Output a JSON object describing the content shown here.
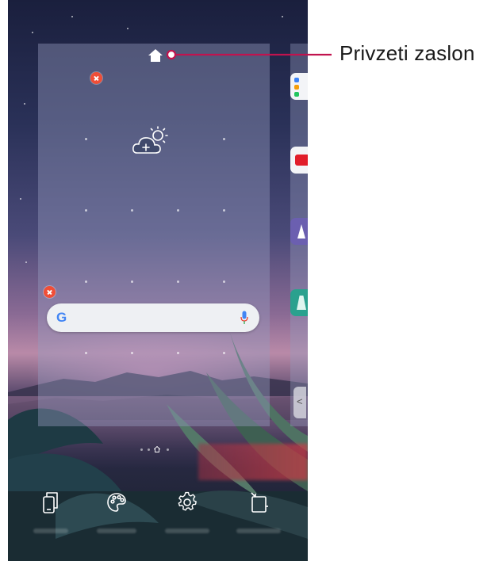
{
  "callout": {
    "label": "Privzeti zaslon"
  },
  "home_card": {
    "widgets": [
      "weather-widget",
      "google-search-bar"
    ]
  },
  "search_bar": {
    "logo": "G",
    "icons": [
      "google-logo",
      "mic-icon"
    ]
  },
  "page_indicator": {
    "pages": 4,
    "current": 2
  },
  "toolbar": {
    "items": [
      "home-screen-icon",
      "palette-icon",
      "gear-icon",
      "wallpaper-icon"
    ]
  },
  "colors": {
    "remove_badge": "#f04e37",
    "callout_line": "#c1134e",
    "google_blue": "#4285f4"
  }
}
